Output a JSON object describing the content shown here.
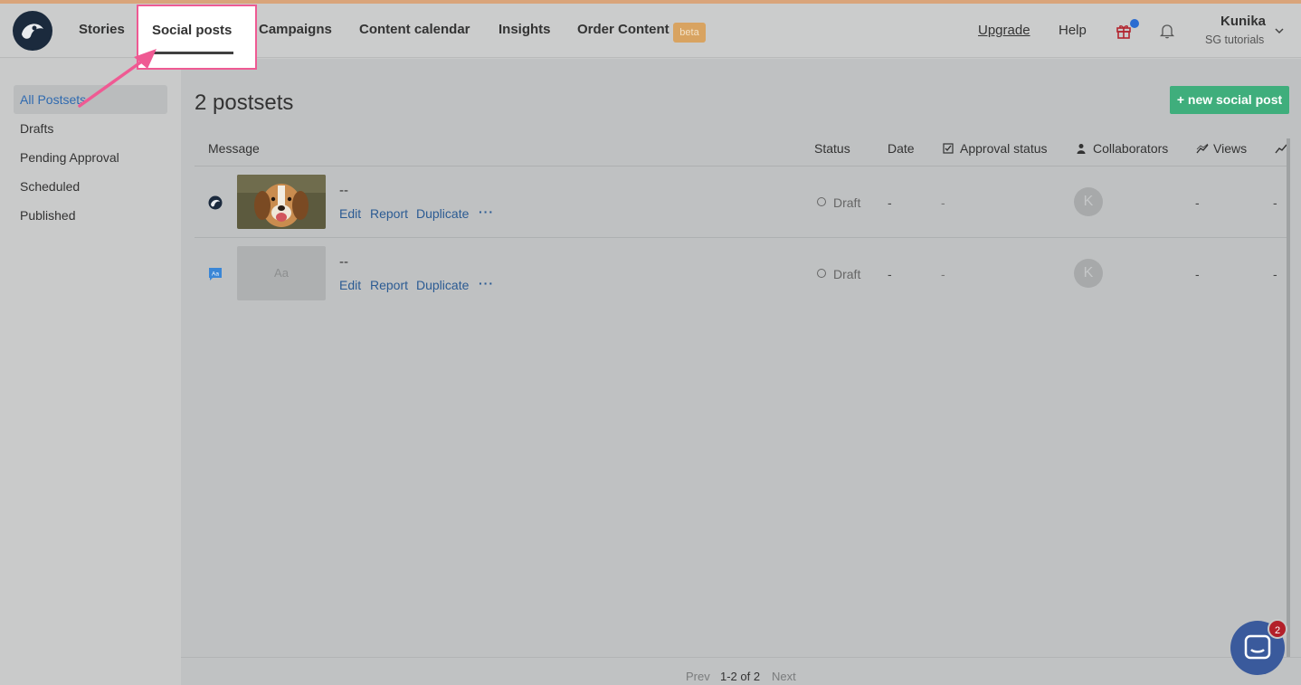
{
  "nav": {
    "items": [
      {
        "label": "Stories"
      },
      {
        "label": "Social posts"
      },
      {
        "label": "Campaigns"
      },
      {
        "label": "Content calendar"
      },
      {
        "label": "Insights"
      },
      {
        "label": "Order Content"
      }
    ],
    "beta_badge": "beta",
    "active": "Social posts",
    "upgrade": "Upgrade",
    "help": "Help",
    "user_name": "Kunika",
    "user_org": "SG tutorials",
    "icons": [
      "gift-icon",
      "bell-icon",
      "chevron-down-icon"
    ]
  },
  "sidebar": {
    "items": [
      {
        "label": "All Postsets",
        "active": true
      },
      {
        "label": "Drafts"
      },
      {
        "label": "Pending Approval"
      },
      {
        "label": "Scheduled"
      },
      {
        "label": "Published"
      }
    ]
  },
  "main": {
    "title": "2 postsets",
    "new_button": "+ new social post",
    "columns": [
      "Message",
      "Status",
      "Date",
      "Approval status",
      "Collaborators",
      "Views"
    ],
    "rows": [
      {
        "network_icon": "storygrid-logo-icon",
        "thumbnail": "dog-photo",
        "message": "--",
        "actions": [
          "Edit",
          "Report",
          "Duplicate",
          "···"
        ],
        "status": "Draft",
        "date": "-",
        "approval": "-",
        "collaborator_initial": "K",
        "views": "-",
        "extra": "-"
      },
      {
        "network_icon": "text-post-icon",
        "thumbnail": "Aa",
        "message": "--",
        "actions": [
          "Edit",
          "Report",
          "Duplicate",
          "···"
        ],
        "status": "Draft",
        "date": "-",
        "approval": "-",
        "collaborator_initial": "K",
        "views": "-",
        "extra": "-"
      }
    ]
  },
  "pagination": {
    "prev": "Prev",
    "range": "1-2 of 2",
    "next": "Next"
  },
  "chat": {
    "badge": "2"
  },
  "colors": {
    "accent_green": "#3fae7c",
    "link_blue": "#2b5b93",
    "highlight_pink": "#ef5a93",
    "beta_orange": "#d8a361"
  }
}
